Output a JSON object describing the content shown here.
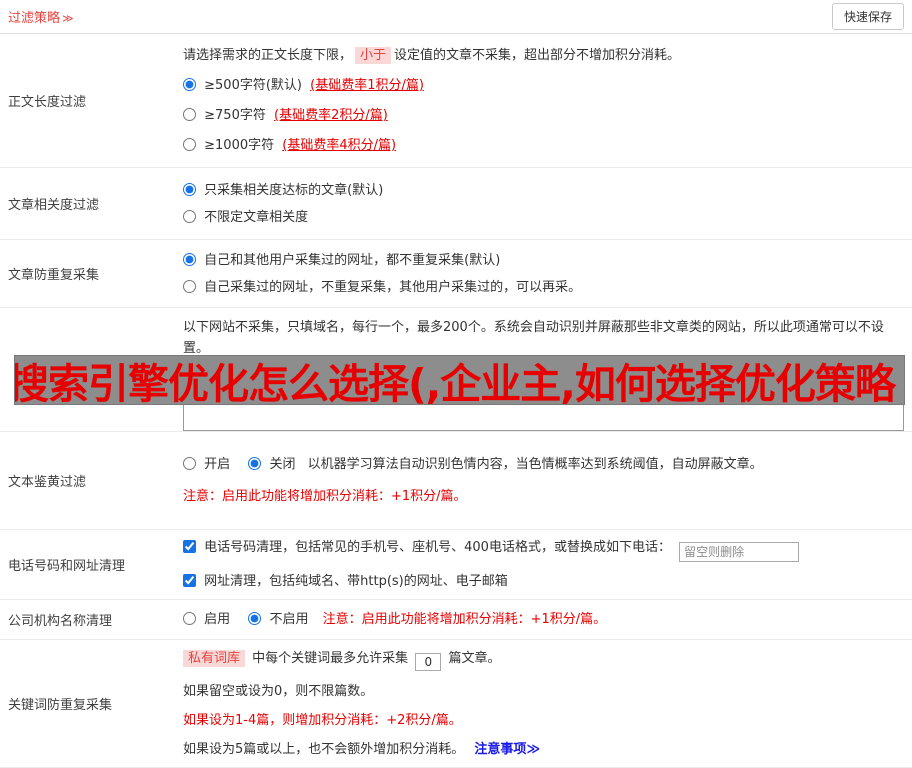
{
  "header": {
    "title": "过滤策略",
    "chevron": "≫",
    "save_button": "快速保存"
  },
  "watermark": {
    "text": "搜索引擎优化怎么选择(,企业主,如何选择优化策略",
    "text_color": "#e60000",
    "bg_color": "#8d8d8d"
  },
  "rows": [
    {
      "label": "正文长度过滤",
      "intro_pre": "请选择需求的正文长度下限，",
      "intro_highlight": "小于",
      "intro_post": "设定值的文章不采集，超出部分不增加积分消耗。",
      "options": [
        {
          "text": "≥500字符(默认)",
          "note": "(基础费率1积分/篇)",
          "selected": true
        },
        {
          "text": "≥750字符",
          "note": "(基础费率2积分/篇)",
          "selected": false
        },
        {
          "text": "≥1000字符",
          "note": "(基础费率4积分/篇)",
          "selected": false
        }
      ]
    },
    {
      "label": "文章相关度过滤",
      "options": [
        {
          "text": "只采集相关度达标的文章(默认)",
          "selected": true
        },
        {
          "text": "不限定文章相关度",
          "selected": false
        }
      ]
    },
    {
      "label": "文章防重复采集",
      "options": [
        {
          "text": "自己和其他用户采集过的网址，都不重复采集(默认)",
          "selected": true
        },
        {
          "text": "自己采集过的网址，不重复采集，其他用户采集过的，可以再采。",
          "selected": false
        }
      ]
    },
    {
      "label": "",
      "desc": "以下网站不采集，只填域名，每行一个，最多200个。系统会自动识别并屏蔽那些非文章类的网站，所以此项通常可以不设置。",
      "textarea_value": ""
    },
    {
      "label": "文本鉴黄过滤",
      "radio_open_label": "开启",
      "radio_close_label": "关闭",
      "radio_open_checked": false,
      "radio_close_checked": true,
      "desc": "以机器学习算法自动识别色情内容，当色情概率达到系统阈值，自动屏蔽文章。",
      "note": "注意：启用此功能将增加积分消耗：+1积分/篇。"
    },
    {
      "label": "电话号码和网址清理",
      "checkbox_phone_label": "电话号码清理，包括常见的手机号、座机号、400电话格式，或替换成如下电话：",
      "checkbox_phone_checked": true,
      "phone_input_placeholder": "留空则删除",
      "phone_input_value": "",
      "checkbox_url_label": "网址清理，包括纯域名、带http(s)的网址、电子邮箱",
      "checkbox_url_checked": true
    },
    {
      "label": "公司机构名称清理",
      "radio_enable_label": "启用",
      "radio_disable_label": "不启用",
      "radio_enable_checked": false,
      "radio_disable_checked": true,
      "note": "注意：启用此功能将增加积分消耗：+1积分/篇。"
    },
    {
      "label": "关键词防重复采集",
      "line1_highlight": "私有词库",
      "line1_mid": "中每个关键词最多允许采集",
      "count_value": "0",
      "line1_end": "篇文章。",
      "line2": "如果留空或设为0，则不限篇数。",
      "line3": "如果设为1-4篇，则增加积分消耗：+2积分/篇。",
      "line4": "如果设为5篇或以上，也不会额外增加积分消耗。",
      "link": "注意事项",
      "link_chevron": "≫"
    }
  ]
}
